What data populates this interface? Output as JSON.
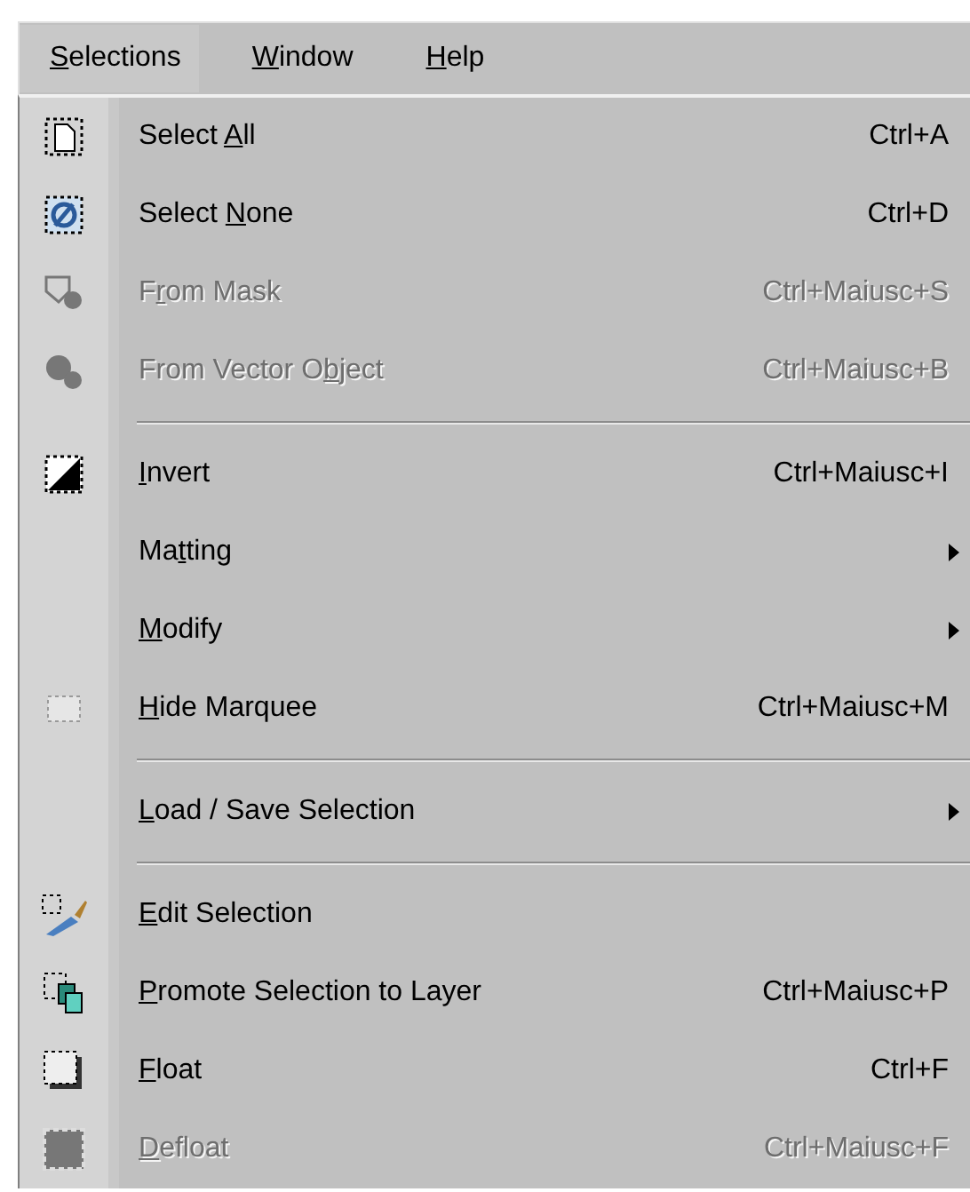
{
  "menubar": [
    {
      "label": {
        "key": "S",
        "post": "elections"
      },
      "selected": true
    },
    {
      "label": {
        "key": "W",
        "post": "indow"
      },
      "selected": false
    },
    {
      "label": {
        "key": "H",
        "post": "elp"
      },
      "selected": false
    }
  ],
  "menu": {
    "items": [
      {
        "kind": "command",
        "label": {
          "pre": "Select ",
          "key": "A",
          "post": "ll"
        },
        "shortcut": "Ctrl+A",
        "disabled": false,
        "submenu": false
      },
      {
        "kind": "command",
        "label": {
          "pre": "Select ",
          "key": "N",
          "post": "one"
        },
        "shortcut": "Ctrl+D",
        "disabled": false,
        "submenu": false
      },
      {
        "kind": "command",
        "label": {
          "pre": "F",
          "key": "r",
          "post": "om Mask"
        },
        "shortcut": "Ctrl+Maiusc+S",
        "disabled": true,
        "submenu": false
      },
      {
        "kind": "command",
        "label": {
          "pre": "From Vector O",
          "key": "b",
          "post": "ject"
        },
        "shortcut": "Ctrl+Maiusc+B",
        "disabled": true,
        "submenu": false
      },
      {
        "kind": "separator"
      },
      {
        "kind": "command",
        "label": {
          "key": "I",
          "post": "nvert"
        },
        "shortcut": "Ctrl+Maiusc+I",
        "disabled": false,
        "submenu": false
      },
      {
        "kind": "command",
        "label": {
          "pre": "Ma",
          "key": "t",
          "post": "ting"
        },
        "disabled": false,
        "submenu": true
      },
      {
        "kind": "command",
        "label": {
          "key": "M",
          "post": "odify"
        },
        "disabled": false,
        "submenu": true
      },
      {
        "kind": "command",
        "label": {
          "key": "H",
          "post": "ide Marquee"
        },
        "shortcut": "Ctrl+Maiusc+M",
        "disabled": false,
        "submenu": false
      },
      {
        "kind": "separator"
      },
      {
        "kind": "command",
        "label": {
          "key": "L",
          "post": "oad / Save Selection"
        },
        "disabled": false,
        "submenu": true
      },
      {
        "kind": "separator"
      },
      {
        "kind": "command",
        "label": {
          "key": "E",
          "post": "dit Selection"
        },
        "disabled": false,
        "submenu": false
      },
      {
        "kind": "command",
        "label": {
          "key": "P",
          "post": "romote Selection to Layer"
        },
        "shortcut": "Ctrl+Maiusc+P",
        "disabled": false,
        "submenu": false
      },
      {
        "kind": "command",
        "label": {
          "key": "F",
          "post": "loat"
        },
        "shortcut": "Ctrl+F",
        "disabled": false,
        "submenu": false
      },
      {
        "kind": "command",
        "label": {
          "key": "D",
          "post": "efloat"
        },
        "shortcut": "Ctrl+Maiusc+F",
        "disabled": true,
        "submenu": false
      }
    ]
  }
}
